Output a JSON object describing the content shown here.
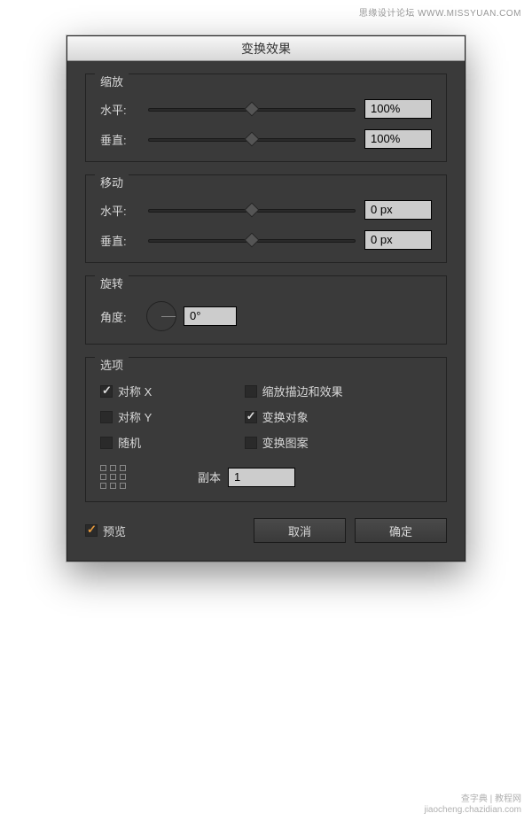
{
  "watermarks": {
    "top": "思缘设计论坛  WWW.MISSYUAN.COM",
    "bottom1": "查字典 | 教程网",
    "bottom2": "jiaocheng.chazidian.com"
  },
  "dialog": {
    "title": "变换效果"
  },
  "scale": {
    "label": "缩放",
    "horizontal_label": "水平:",
    "horizontal_value": "100%",
    "vertical_label": "垂直:",
    "vertical_value": "100%"
  },
  "move": {
    "label": "移动",
    "horizontal_label": "水平:",
    "horizontal_value": "0 px",
    "vertical_label": "垂直:",
    "vertical_value": "0 px"
  },
  "rotate": {
    "label": "旋转",
    "angle_label": "角度:",
    "angle_value": "0°"
  },
  "options": {
    "label": "选项",
    "reflect_x": "对称 X",
    "reflect_y": "对称 Y",
    "random": "随机",
    "scale_strokes": "缩放描边和效果",
    "transform_objects": "变换对象",
    "transform_patterns": "变换图案",
    "copies_label": "副本",
    "copies_value": "1",
    "states": {
      "reflect_x": true,
      "reflect_y": false,
      "random": false,
      "scale_strokes": false,
      "transform_objects": true,
      "transform_patterns": false
    }
  },
  "footer": {
    "preview": "预览",
    "preview_on": true,
    "cancel": "取消",
    "ok": "确定"
  }
}
